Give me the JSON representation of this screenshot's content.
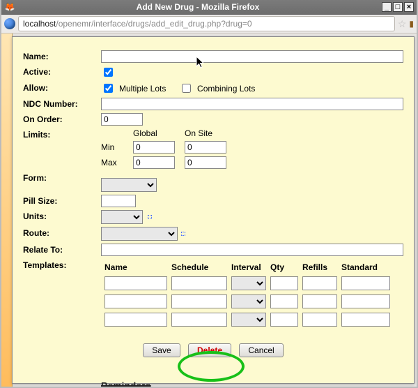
{
  "window": {
    "title": "Add New Drug - Mozilla Firefox"
  },
  "url": {
    "host": "localhost",
    "path": "/openemr/interface/drugs/add_edit_drug.php?drug=0"
  },
  "labels": {
    "name": "Name:",
    "active": "Active:",
    "allow": "Allow:",
    "ndc": "NDC Number:",
    "on_order": "On Order:",
    "limits": "Limits:",
    "form": "Form:",
    "pill_size": "Pill Size:",
    "units": "Units:",
    "route": "Route:",
    "relate_to": "Relate To:",
    "templates": "Templates:"
  },
  "allow": {
    "multiple": "Multiple Lots",
    "combining": "Combining Lots",
    "multiple_checked": true,
    "combining_checked": false
  },
  "active_checked": true,
  "on_order_value": "0",
  "limits": {
    "global": "Global",
    "onsite": "On Site",
    "min": "Min",
    "max": "Max",
    "min_global": "0",
    "min_onsite": "0",
    "max_global": "0",
    "max_onsite": "0"
  },
  "templates": {
    "headers": {
      "name": "Name",
      "schedule": "Schedule",
      "interval": "Interval",
      "qty": "Qty",
      "refills": "Refills",
      "standard": "Standard"
    }
  },
  "buttons": {
    "save": "Save",
    "delete": "Delete",
    "cancel": "Cancel"
  },
  "fragments": {
    "reminders": "Reminders"
  }
}
